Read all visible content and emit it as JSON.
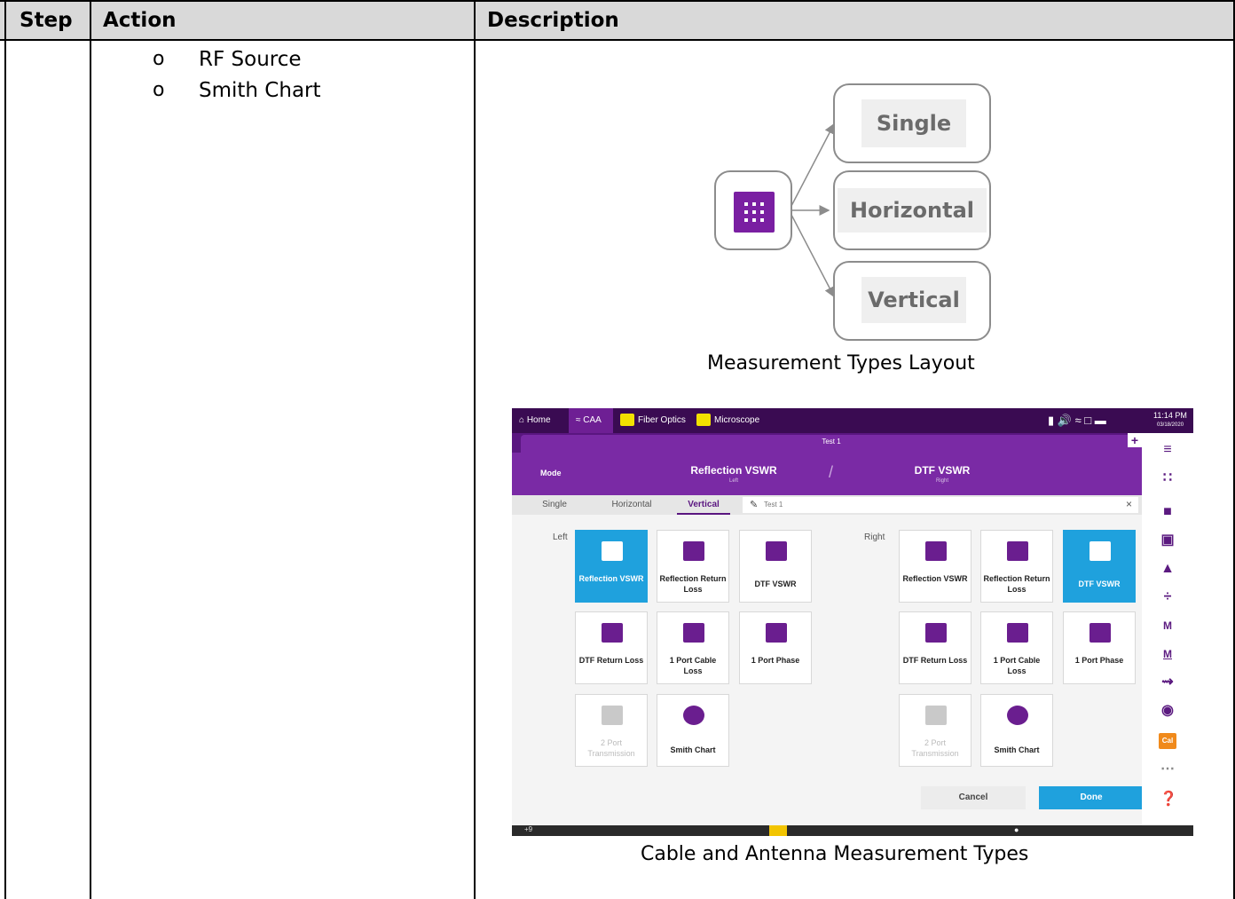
{
  "table": {
    "headers": [
      "Step",
      "Action",
      "Description"
    ],
    "action_bullets": [
      {
        "mark": "o",
        "text": "RF Source"
      },
      {
        "mark": "o",
        "text": "Smith Chart"
      }
    ]
  },
  "diagram": {
    "options": [
      "Single",
      "Horizontal",
      "Vertical"
    ],
    "caption": "Measurement Types Layout"
  },
  "screenshot": {
    "caption": "Cable and Antenna Measurement Types",
    "topbar": {
      "home": "Home",
      "caa": "CAA",
      "fiber": "Fiber Optics",
      "microscope": "Microscope",
      "time": "11:14 PM",
      "date": "03/18/2020"
    },
    "test_tab": "Test 1",
    "mode_label": "Mode",
    "left_mode": {
      "title": "Reflection VSWR",
      "sub": "Left"
    },
    "right_mode": {
      "title": "DTF VSWR",
      "sub": "Right"
    },
    "layout_tabs": [
      "Single",
      "Horizontal",
      "Vertical"
    ],
    "active_layout": "Vertical",
    "name_field": "Test 1",
    "left_label": "Left",
    "right_label": "Right",
    "tiles": [
      "Reflection VSWR",
      "Reflection Return Loss",
      "DTF VSWR",
      "DTF Return Loss",
      "1 Port Cable Loss",
      "1 Port Phase",
      "2 Port Transmission",
      "Smith Chart"
    ],
    "left_selected": "Reflection VSWR",
    "right_selected": "DTF VSWR",
    "cancel": "Cancel",
    "done": "Done",
    "cal": "Cal",
    "bottom_count": "+9"
  }
}
